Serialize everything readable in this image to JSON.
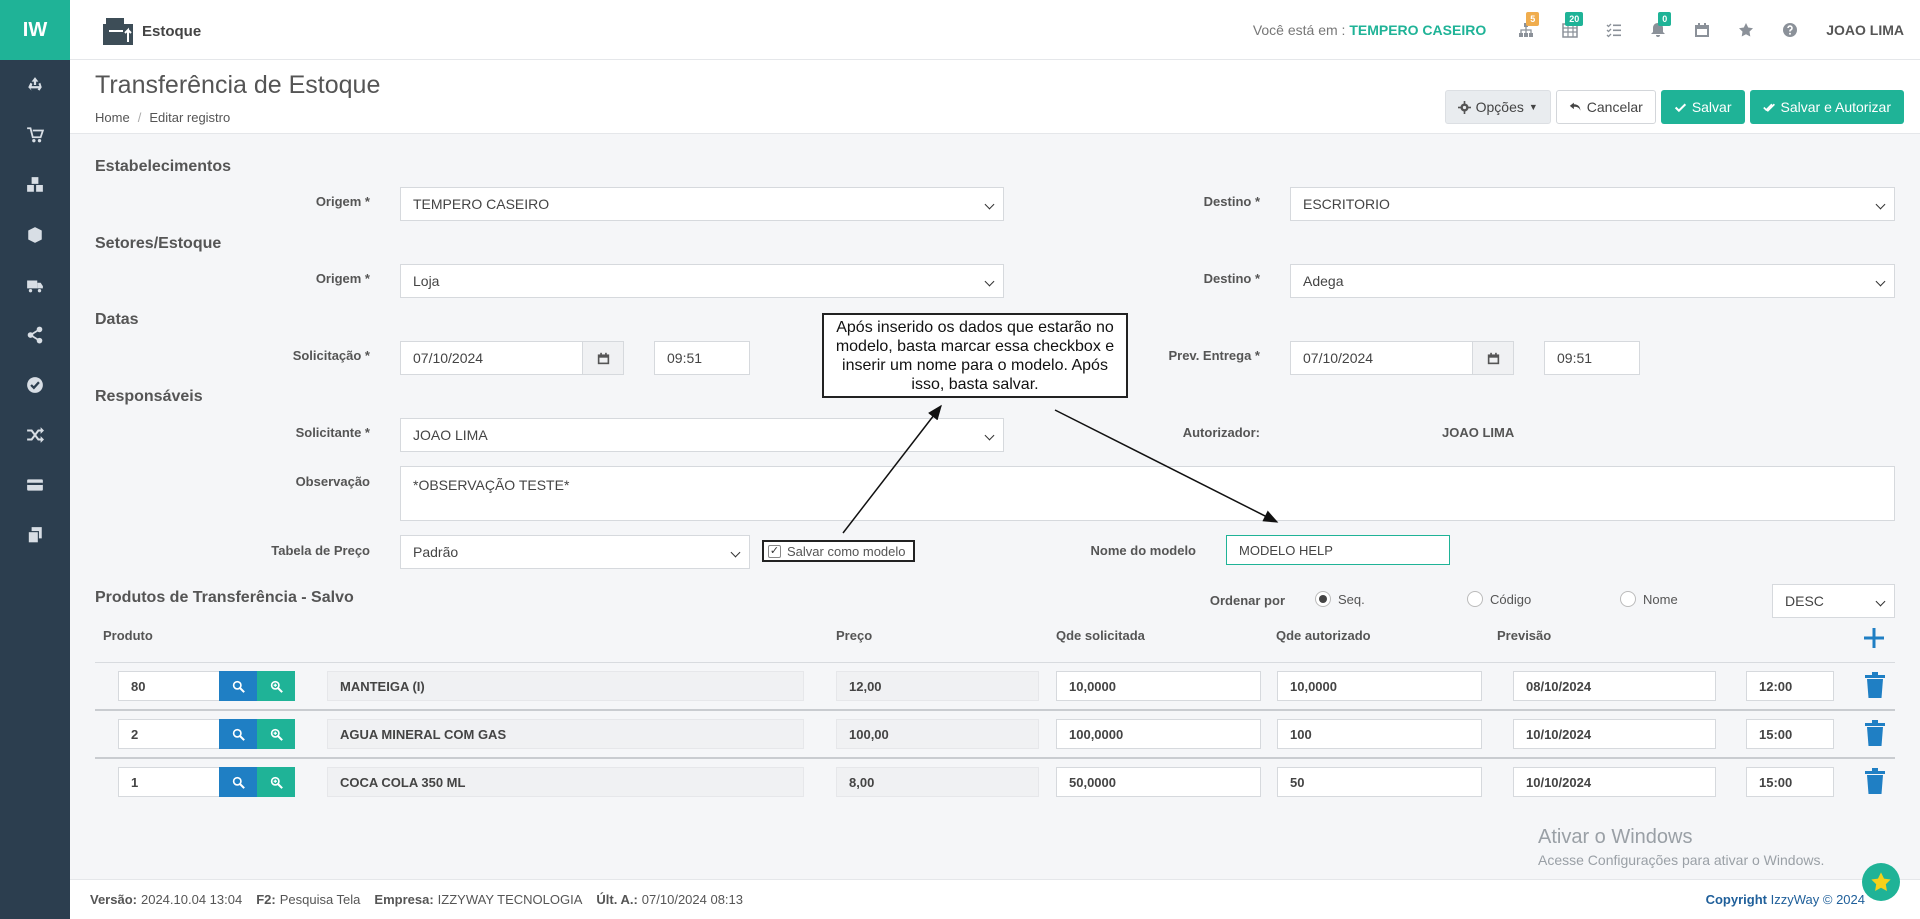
{
  "app": {
    "logo": "IW",
    "module": "Estoque",
    "location_label": "Você está em :",
    "location_value": "TEMPERO CASEIRO",
    "user": "JOAO LIMA"
  },
  "topbar": {
    "badges": {
      "tree": "5",
      "grid": "20",
      "bell": "0"
    }
  },
  "sidebar": [
    "recycle-icon",
    "cart-icon",
    "cubes-icon",
    "box-icon",
    "truck-icon",
    "share-icon",
    "check-circle-icon",
    "random-icon",
    "card-icon",
    "copy-icon"
  ],
  "page": {
    "title": "Transferência de Estoque",
    "breadcrumb": [
      "Home",
      "Editar registro"
    ]
  },
  "buttons": {
    "options": "Opções",
    "cancel": "Cancelar",
    "save": "Salvar",
    "save_authorize": "Salvar e Autorizar"
  },
  "sections": {
    "establishments": "Estabelecimentos",
    "sectors": "Setores/Estoque",
    "dates": "Datas",
    "responsibles": "Responsáveis",
    "products": "Produtos de Transferência - Salvo"
  },
  "form": {
    "est_origin_label": "Origem *",
    "est_origin": "TEMPERO CASEIRO",
    "est_dest_label": "Destino *",
    "est_dest": "ESCRITORIO",
    "sec_origin_label": "Origem *",
    "sec_origin": "Loja",
    "sec_dest_label": "Destino *",
    "sec_dest": "Adega",
    "request_label": "Solicitação *",
    "request_date": "07/10/2024",
    "request_time": "09:51",
    "delivery_label": "Prev. Entrega *",
    "delivery_date": "07/10/2024",
    "delivery_time": "09:51",
    "requester_label": "Solicitante *",
    "requester": "JOAO LIMA",
    "authorizer_label": "Autorizador:",
    "authorizer": "JOAO LIMA",
    "notes_label": "Observação",
    "notes": "*OBSERVAÇÃO TESTE*",
    "price_table_label": "Tabela de Preço",
    "price_table": "Padrão",
    "save_model_label": "Salvar como modelo",
    "save_model_checked": true,
    "model_name_label": "Nome do modelo",
    "model_name": "MODELO HELP"
  },
  "annotation": "Após inserido os dados que estarão no modelo, basta marcar essa checkbox e inserir um nome para o modelo. Após isso, basta salvar.",
  "sort": {
    "label": "Ordenar por",
    "options": [
      "Seq.",
      "Código",
      "Nome"
    ],
    "selected": "Seq.",
    "direction": "DESC"
  },
  "table": {
    "headers": {
      "product": "Produto",
      "price": "Preço",
      "qty_requested": "Qde solicitada",
      "qty_authorized": "Qde autorizado",
      "forecast": "Previsão"
    },
    "rows": [
      {
        "code": "80",
        "name": "MANTEIGA (I)",
        "price": "12,00",
        "qty_requested": "10,0000",
        "qty_authorized": "10,0000",
        "date": "08/10/2024",
        "time": "12:00"
      },
      {
        "code": "2",
        "name": "AGUA MINERAL COM GAS",
        "price": "100,00",
        "qty_requested": "100,0000",
        "qty_authorized": "100",
        "date": "10/10/2024",
        "time": "15:00"
      },
      {
        "code": "1",
        "name": "COCA COLA 350 ML",
        "price": "8,00",
        "qty_requested": "50,0000",
        "qty_authorized": "50",
        "date": "10/10/2024",
        "time": "15:00"
      }
    ]
  },
  "watermark": {
    "line1": "Ativar o Windows",
    "line2": "Acesse Configurações para ativar o Windows."
  },
  "footer": {
    "version_label": "Versão:",
    "version": "2024.10.04 13:04",
    "f2_label": "F2:",
    "f2": "Pesquisa Tela",
    "company_label": "Empresa:",
    "company": "IZZYWAY TECNOLOGIA",
    "last_label": "Últ. A.:",
    "last": "07/10/2024 08:13",
    "copyright_prefix": "Copyright",
    "copyright_brand": "IzzyWay",
    "copyright_year": "© 2024"
  }
}
